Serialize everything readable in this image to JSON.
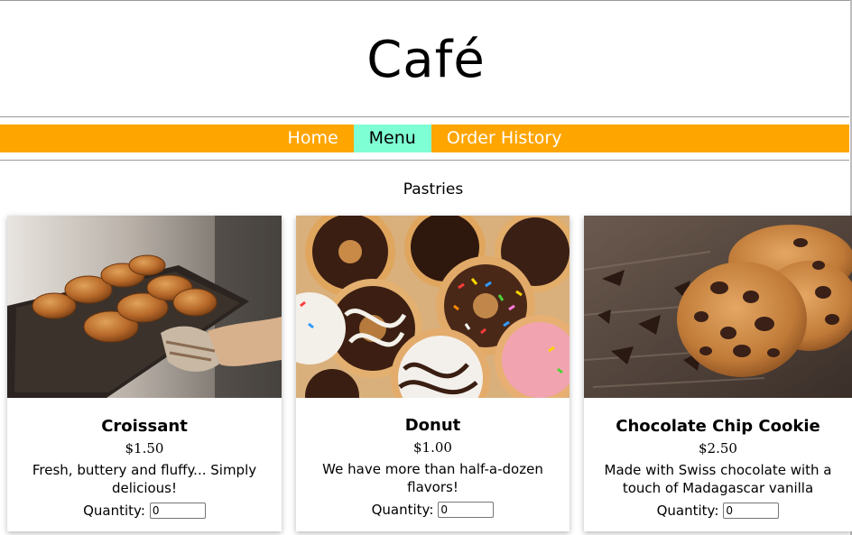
{
  "site": {
    "title": "Café"
  },
  "nav": {
    "items": [
      {
        "label": "Home",
        "active": false
      },
      {
        "label": "Menu",
        "active": true
      },
      {
        "label": "Order History",
        "active": false
      }
    ]
  },
  "section": {
    "title": "Pastries"
  },
  "products": [
    {
      "name": "Croissant",
      "price": "$1.50",
      "description": "Fresh, buttery and fluffy... Simply delicious!",
      "quantity_label": "Quantity:",
      "quantity_value": "0",
      "image": "croissants-on-baking-tray-photo"
    },
    {
      "name": "Donut",
      "price": "$1.00",
      "description": "We have more than half-a-dozen flavors!",
      "quantity_label": "Quantity:",
      "quantity_value": "0",
      "image": "assorted-glazed-donuts-photo"
    },
    {
      "name": "Chocolate Chip Cookie",
      "price": "$2.50",
      "description": "Made with Swiss chocolate with a touch of Madagascar vanilla",
      "quantity_label": "Quantity:",
      "quantity_value": "0",
      "image": "chocolate-chip-cookies-photo"
    }
  ],
  "colors": {
    "nav_background": "#ffa500",
    "nav_active": "#7fffd4",
    "nav_text": "#ffffff"
  }
}
